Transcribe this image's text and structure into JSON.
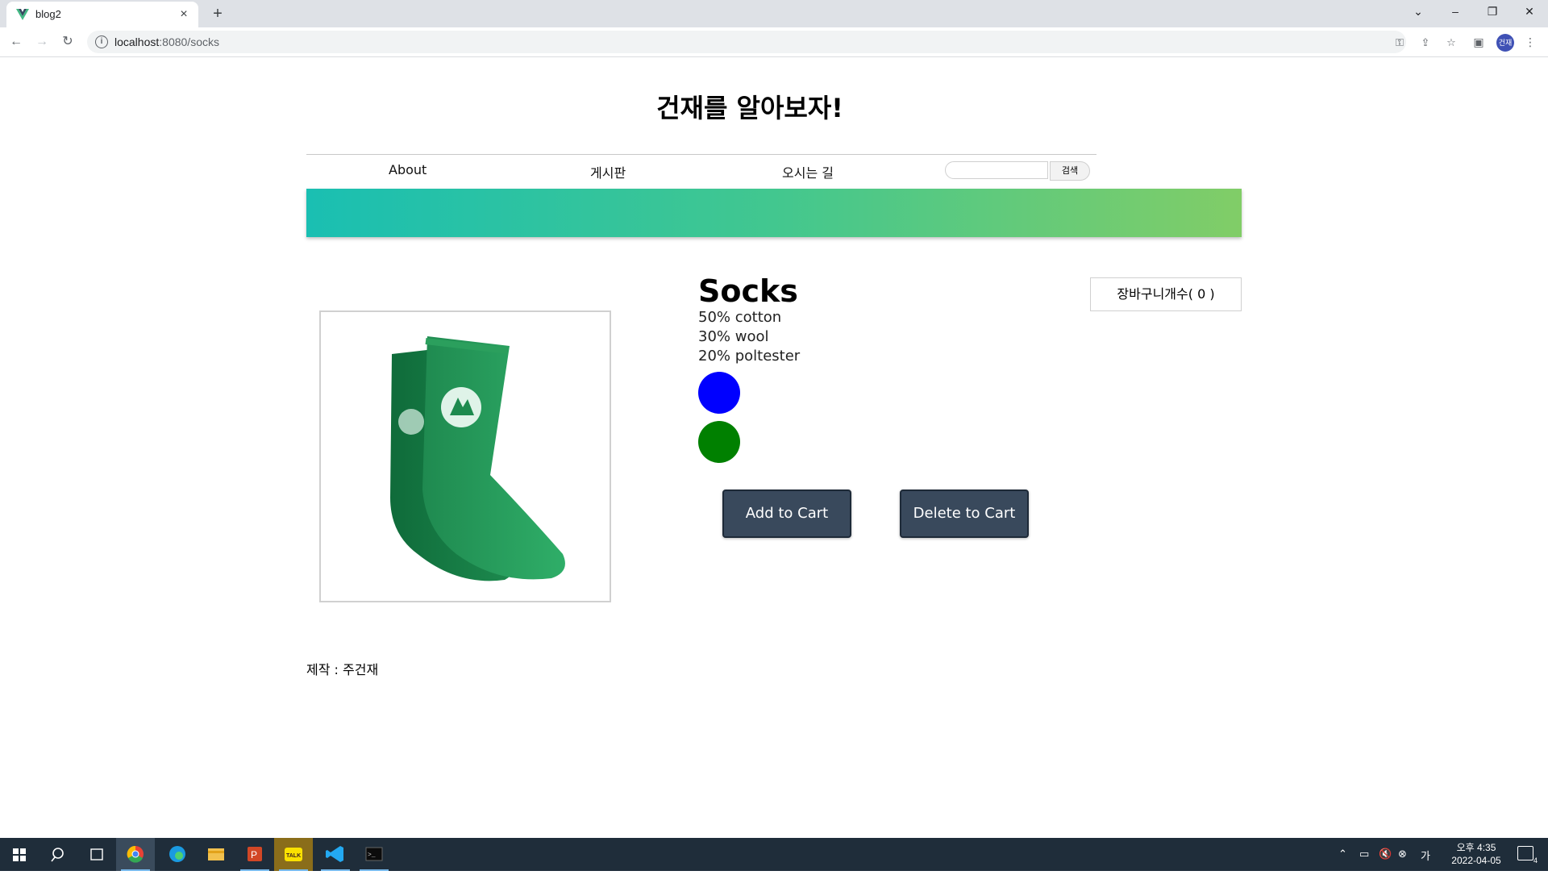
{
  "browser": {
    "tab_title": "blog2",
    "url_host": "localhost",
    "url_rest": ":8080/socks",
    "new_tab_label": "+",
    "profile_label": "건재"
  },
  "site": {
    "title": "건재를 알아보자!",
    "nav": [
      "About",
      "게시판",
      "오시는 길"
    ],
    "search_placeholder": "",
    "search_button": "검색"
  },
  "product": {
    "name": "Socks",
    "materials": [
      "50% cotton",
      "30% wool",
      "20% poltester"
    ],
    "variant_colors": [
      "#0000ff",
      "#008000"
    ],
    "cart_label": "장바구니개수( 0 )",
    "cart_count": 0,
    "add_button": "Add to Cart",
    "delete_button": "Delete to Cart"
  },
  "footer": {
    "credit": "제작 : 주건재"
  },
  "taskbar": {
    "time": "오후 4:35",
    "date": "2022-04-05",
    "notification_count": "4"
  }
}
